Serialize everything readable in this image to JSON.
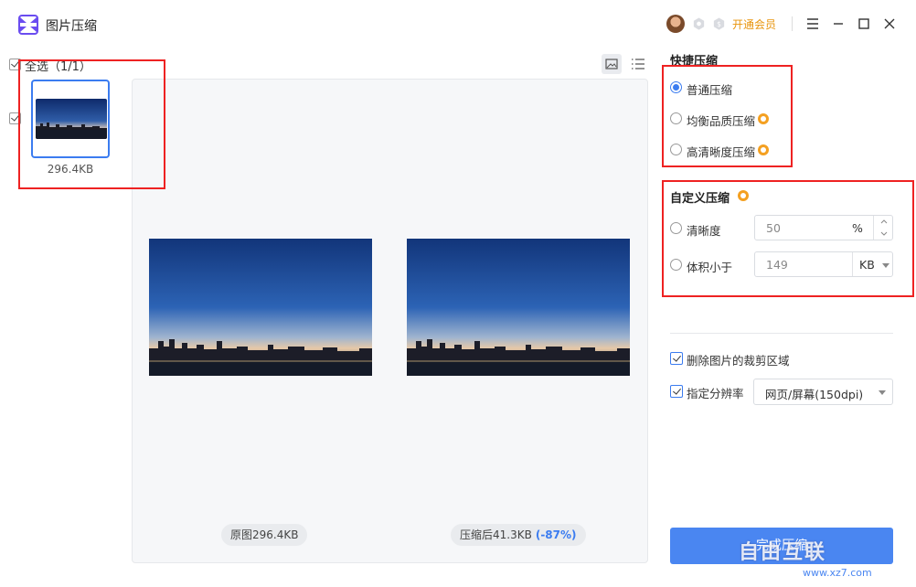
{
  "app": {
    "title": "图片压缩"
  },
  "header": {
    "vip_label": "开通会员"
  },
  "file_list": {
    "select_all_label": "全选（1/1）",
    "items": [
      {
        "size": "296.4KB",
        "checked": true
      }
    ]
  },
  "preview": {
    "original_label": "原图296.4KB",
    "compressed_label": "压缩后41.3KB",
    "compressed_percent": "(-87%)"
  },
  "quick_compress": {
    "title": "快捷压缩",
    "options": [
      {
        "label": "普通压缩",
        "selected": true,
        "vip": false
      },
      {
        "label": "均衡品质压缩",
        "selected": false,
        "vip": true
      },
      {
        "label": "高清晰度压缩",
        "selected": false,
        "vip": true
      }
    ]
  },
  "custom_compress": {
    "title": "自定义压缩",
    "clarity": {
      "label": "清晰度",
      "value": "50",
      "unit": "%"
    },
    "size_limit": {
      "label": "体积小于",
      "value": "149",
      "unit": "KB"
    }
  },
  "options": {
    "remove_crop": {
      "label": "删除图片的裁剪区域",
      "checked": true
    },
    "set_resolution": {
      "label": "指定分辨率",
      "checked": true
    },
    "resolution_value": "网页/屏幕(150dpi)"
  },
  "actions": {
    "finish_label": "完成压缩"
  },
  "watermark": {
    "text": "自由互联",
    "url": "www.xz7.com"
  },
  "colors": {
    "accent": "#3b7cf0",
    "vip": "#e8940c",
    "highlight": "#e22222"
  }
}
